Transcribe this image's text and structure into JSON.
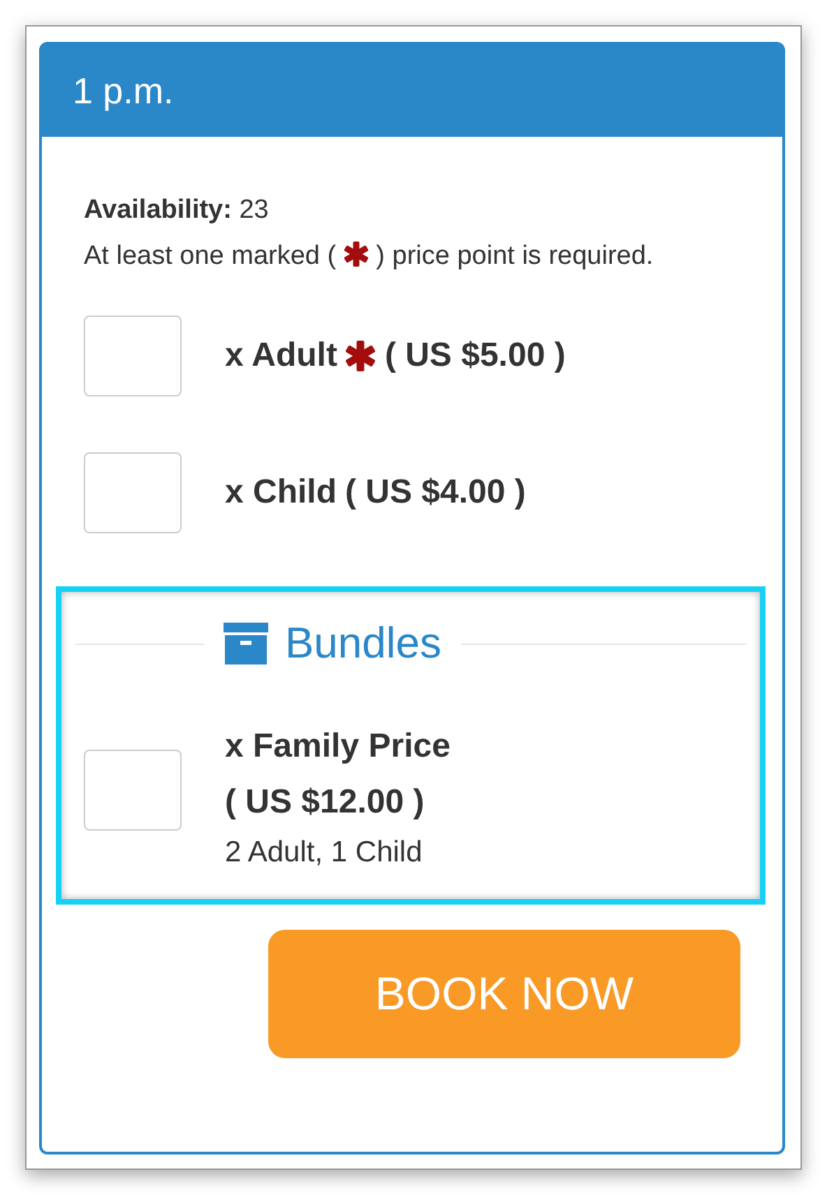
{
  "panel": {
    "title": "1 p.m."
  },
  "availability": {
    "label": "Availability:",
    "value": "23"
  },
  "notice": {
    "before": "At least one marked (",
    "after": ") price point is required."
  },
  "price_points": [
    {
      "name": "x Adult",
      "required": true,
      "price": "( US $5.00 )"
    },
    {
      "name": "x Child",
      "required": false,
      "price": "( US $4.00 )"
    }
  ],
  "bundles": {
    "legend": "Bundles",
    "highlighted": true,
    "items": [
      {
        "name": "x Family Price",
        "price": "( US $12.00 )",
        "details": "2 Adult, 1 Child"
      }
    ]
  },
  "button": {
    "label": "BOOK NOW"
  }
}
